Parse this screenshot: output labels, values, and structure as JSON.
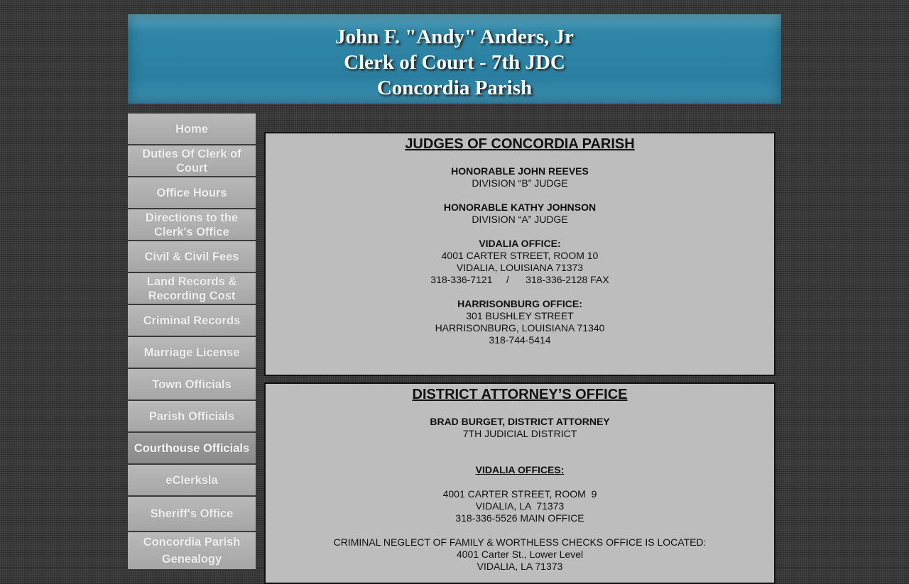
{
  "header": {
    "line1": "John F. \"Andy\" Anders, Jr",
    "line2": "Clerk of Court - 7th JDC",
    "line3": "Concordia Parish"
  },
  "nav": {
    "items": [
      {
        "label": "Home"
      },
      {
        "label": "Duties Of Clerk of Court"
      },
      {
        "label": "Office Hours"
      },
      {
        "label": "Directions to the Clerk's Office"
      },
      {
        "label": "Civil & Civil Fees"
      },
      {
        "label": "Land Records & Recording Cost"
      },
      {
        "label": "Criminal Records"
      },
      {
        "label": "Marriage License"
      },
      {
        "label": "Town Officials"
      },
      {
        "label": "Parish Officials"
      },
      {
        "label": "Courthouse Officials"
      },
      {
        "label": "eClerksla"
      },
      {
        "label": "Sheriff's Office"
      },
      {
        "label": "Concordia Parish Genealogy"
      }
    ]
  },
  "judges": {
    "title": "JUDGES OF CONCORDIA PARISH",
    "judge1_name": "HONORABLE JOHN REEVES",
    "judge1_div": "DIVISION “B” JUDGE",
    "judge2_name": "HONORABLE KATHY JOHNSON",
    "judge2_div": "DIVISION “A” JUDGE",
    "vidalia_heading": "VIDALIA OFFICE:",
    "vidalia_street": "4001 CARTER STREET, ROOM 10",
    "vidalia_city": "VIDALIA, LOUISIANA  71373",
    "vidalia_phone": "318-336-7121     /      318-336-2128 FAX",
    "harrisonburg_heading": "HARRISONBURG OFFICE:",
    "harrisonburg_street": "301 BUSHLEY STREET",
    "harrisonburg_city": "HARRISONBURG, LOUISIANA  71340",
    "harrisonburg_phone": "318-744-5414"
  },
  "da": {
    "title": "DISTRICT ATTORNEY’S OFFICE",
    "name": "BRAD BURGET, DISTRICT ATTORNEY",
    "district": "7TH JUDICIAL DISTRICT",
    "offices_heading": "VIDALIA OFFICES:",
    "street": "4001 CARTER STREET, ROOM  9",
    "city": "VIDALIA, LA  71373",
    "phone": "318-336-5526 MAIN OFFICE",
    "neglect_note": "CRIMINAL NEGLECT OF FAMILY & WORTHLESS CHECKS OFFICE IS LOCATED:",
    "neglect_street": "4001 Carter St., Lower Level",
    "neglect_city": "VIDALIA, LA 71373"
  },
  "colors": {
    "banner": "#2a7fa0",
    "nav_bg": "#adadad",
    "panel_bg": "#bdbdbd",
    "page_bg": "#3a3a3a"
  }
}
